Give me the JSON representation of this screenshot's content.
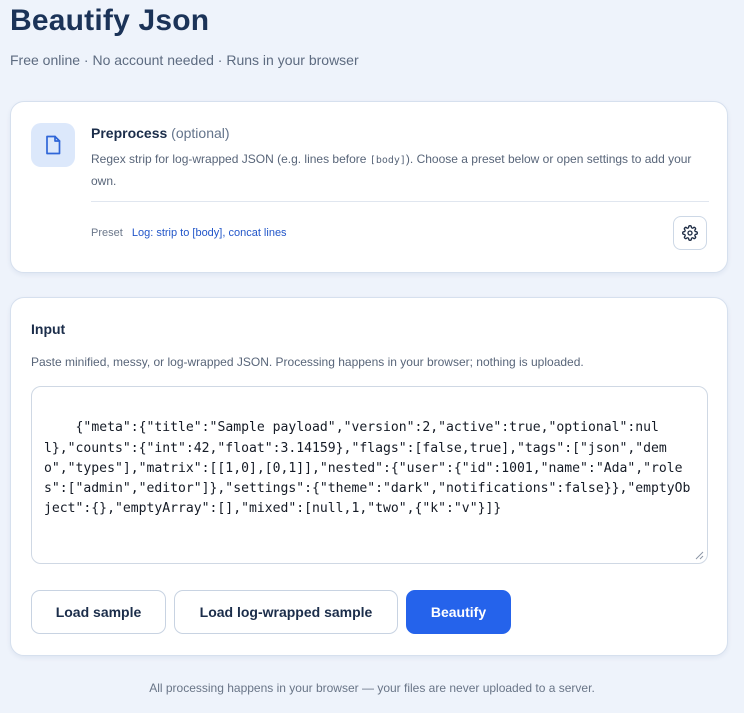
{
  "header": {
    "title": "Beautify Json",
    "subtitle": "Free online · No account needed · Runs in your browser"
  },
  "preprocess": {
    "icon": "document-icon",
    "title": "Preprocess",
    "optional_label": "(optional)",
    "description_before": "Regex strip for log-wrapped JSON (e.g. lines before ",
    "description_code": "[body]",
    "description_after": "). Choose a preset below or open settings to add your own.",
    "preset_label": "Preset",
    "preset_value": "Log: strip to [body], concat lines",
    "settings_icon": "gear-icon"
  },
  "input": {
    "title": "Input",
    "description": "Paste minified, messy, or log-wrapped JSON. Processing happens in your browser; nothing is uploaded.",
    "json_text": "{\"meta\":{\"title\":\"Sample payload\",\"version\":2,\"active\":true,\"optional\":null},\"counts\":{\"int\":42,\"float\":3.14159},\"flags\":[false,true],\"tags\":[\"json\",\"demo\",\"types\"],\"matrix\":[[1,0],[0,1]],\"nested\":{\"user\":{\"id\":1001,\"name\":\"Ada\",\"roles\":[\"admin\",\"editor\"]},\"settings\":{\"theme\":\"dark\",\"notifications\":false}},\"emptyObject\":{},\"emptyArray\":[],\"mixed\":[null,1,\"two\",{\"k\":\"v\"}]}"
  },
  "actions": {
    "load_sample": "Load sample",
    "load_log_sample": "Load log-wrapped sample",
    "beautify": "Beautify"
  },
  "footer": {
    "text": "All processing happens in your browser — your files are never uploaded to a server."
  },
  "colors": {
    "background": "#eef3fb",
    "accent": "#2563eb",
    "title": "#1b3358",
    "link": "#2256c9"
  }
}
